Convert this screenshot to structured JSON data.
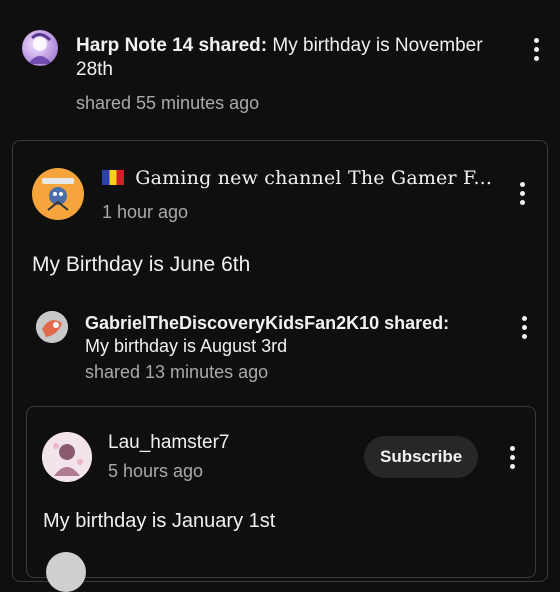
{
  "post1": {
    "author": "Harp Note 14",
    "shared_word": "shared:",
    "text_line1": "My birthday is November",
    "text_line2": "28th",
    "time": "shared 55 minutes ago"
  },
  "post2": {
    "flag_icon": "flag-icon",
    "channel": "Gaming new channel The Gamer F...",
    "time": "1 hour ago",
    "body": "My Birthday is June 6th"
  },
  "post3": {
    "author": "GabrielTheDiscoveryKidsFan2K10",
    "shared_word": "shared:",
    "text": "My birthday is August 3rd",
    "time": "shared 13 minutes ago"
  },
  "post4": {
    "author": "Lau_hamster7",
    "time": "5 hours ago",
    "subscribe_label": "Subscribe",
    "body": "My birthday is January 1st"
  },
  "colors": {
    "background": "#0f0f0f",
    "card_border": "#3a3a3a",
    "muted_text": "#aaaaaa",
    "button_bg": "#272727"
  }
}
